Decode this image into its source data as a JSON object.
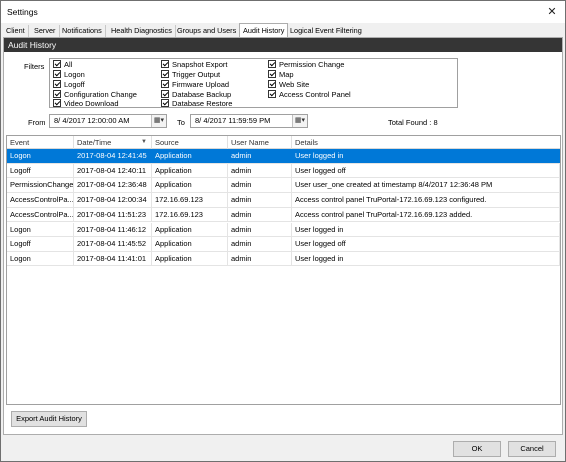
{
  "window": {
    "title": "Settings"
  },
  "tabs": [
    {
      "label": "Client"
    },
    {
      "label": "Server"
    },
    {
      "label": "Notifications"
    },
    {
      "label": "Health Diagnostics"
    },
    {
      "label": "Groups and Users"
    },
    {
      "label": "Audit History",
      "active": true
    },
    {
      "label": "Logical Event Filtering"
    }
  ],
  "audit": {
    "header": "Audit History",
    "filters_label": "Filters",
    "filters": [
      {
        "label": "All",
        "checked": true
      },
      {
        "label": "Logon",
        "checked": true
      },
      {
        "label": "Logoff",
        "checked": true
      },
      {
        "label": "Configuration Change",
        "checked": true
      },
      {
        "label": "Video Download",
        "checked": true
      },
      {
        "label": "Snapshot Export",
        "checked": true
      },
      {
        "label": "Trigger Output",
        "checked": true
      },
      {
        "label": "Firmware Upload",
        "checked": true
      },
      {
        "label": "Database Backup",
        "checked": true
      },
      {
        "label": "Database Restore",
        "checked": true
      },
      {
        "label": "Permission Change",
        "checked": true
      },
      {
        "label": "Map",
        "checked": true
      },
      {
        "label": "Web Site",
        "checked": true
      },
      {
        "label": "Access Control Panel",
        "checked": true
      }
    ],
    "from_label": "From",
    "from_value": "8/ 4/2017 12:00:00 AM",
    "to_label": "To",
    "to_value": "8/ 4/2017 11:59:59 PM",
    "total_found": "Total Found : 8",
    "columns": [
      "Event",
      "Date/Time",
      "Source",
      "User Name",
      "Details"
    ],
    "rows": [
      {
        "event": "Logon",
        "datetime": "2017-08-04 12:41:45",
        "source": "Application",
        "user": "admin",
        "details": "User logged in",
        "selected": true
      },
      {
        "event": "Logoff",
        "datetime": "2017-08-04 12:40:11",
        "source": "Application",
        "user": "admin",
        "details": "User logged off"
      },
      {
        "event": "PermissionChange",
        "datetime": "2017-08-04 12:36:48",
        "source": "Application",
        "user": "admin",
        "details": "User user_one created at timestamp 8/4/2017 12:36:48 PM"
      },
      {
        "event": "AccessControlPa...",
        "datetime": "2017-08-04 12:00:34",
        "source": "172.16.69.123",
        "user": "admin",
        "details": "Access control panel TruPortal-172.16.69.123 configured."
      },
      {
        "event": "AccessControlPa...",
        "datetime": "2017-08-04 11:51:23",
        "source": "172.16.69.123",
        "user": "admin",
        "details": "Access control panel TruPortal-172.16.69.123 added."
      },
      {
        "event": "Logon",
        "datetime": "2017-08-04 11:46:12",
        "source": "Application",
        "user": "admin",
        "details": "User logged in"
      },
      {
        "event": "Logoff",
        "datetime": "2017-08-04 11:45:52",
        "source": "Application",
        "user": "admin",
        "details": "User logged off"
      },
      {
        "event": "Logon",
        "datetime": "2017-08-04 11:41:01",
        "source": "Application",
        "user": "admin",
        "details": "User logged in"
      }
    ],
    "export_label": "Export Audit History"
  },
  "footer": {
    "ok_label": "OK",
    "cancel_label": "Cancel"
  },
  "icons": {
    "close": "close-icon",
    "date_picker": "calendar-dropdown-icon",
    "sort": "sort-descending-icon"
  },
  "colors": {
    "selection": "#0078d7",
    "section_header": "#353535"
  }
}
